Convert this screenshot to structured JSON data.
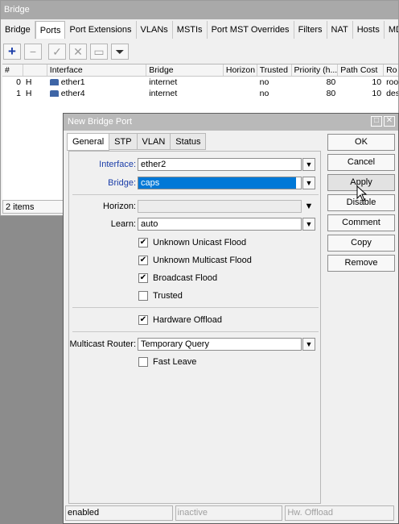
{
  "bridge_window": {
    "title": "Bridge",
    "tabs": [
      "Bridge",
      "Ports",
      "Port Extensions",
      "VLANs",
      "MSTIs",
      "Port MST Overrides",
      "Filters",
      "NAT",
      "Hosts",
      "MD"
    ],
    "active_tab": "Ports",
    "toolbar": [
      "add-icon",
      "remove-icon",
      "enable-icon",
      "disable-icon",
      "comment-icon",
      "filter-icon"
    ],
    "columns": [
      "#",
      "Interface",
      "Bridge",
      "Horizon",
      "Trusted",
      "Priority (h...",
      "Path Cost",
      "Ro"
    ],
    "rows": [
      {
        "num": "0",
        "flag": "H",
        "interface": "ether1",
        "bridge": "internet",
        "horizon": "",
        "trusted": "no",
        "priority": "80",
        "path_cost": "10",
        "role": "roo"
      },
      {
        "num": "1",
        "flag": "H",
        "interface": "ether4",
        "bridge": "internet",
        "horizon": "",
        "trusted": "no",
        "priority": "80",
        "path_cost": "10",
        "role": "des"
      }
    ],
    "status": "2 items"
  },
  "dialog": {
    "title": "New Bridge Port",
    "tabs": [
      "General",
      "STP",
      "VLAN",
      "Status"
    ],
    "active_tab": "General",
    "fields": {
      "interface": {
        "label": "Interface:",
        "value": "ether2"
      },
      "bridge": {
        "label": "Bridge:",
        "value": "caps"
      },
      "horizon": {
        "label": "Horizon:",
        "value": ""
      },
      "learn": {
        "label": "Learn:",
        "value": "auto"
      },
      "multicast_router": {
        "label": "Multicast Router:",
        "value": "Temporary Query"
      }
    },
    "checkboxes": {
      "unknown_unicast_flood": {
        "label": "Unknown Unicast Flood",
        "checked": true
      },
      "unknown_multicast_flood": {
        "label": "Unknown Multicast Flood",
        "checked": true
      },
      "broadcast_flood": {
        "label": "Broadcast Flood",
        "checked": true
      },
      "trusted": {
        "label": "Trusted",
        "checked": false
      },
      "hardware_offload": {
        "label": "Hardware Offload",
        "checked": true
      },
      "fast_leave": {
        "label": "Fast Leave",
        "checked": false
      }
    },
    "buttons": [
      "OK",
      "Cancel",
      "Apply",
      "Disable",
      "Comment",
      "Copy",
      "Remove"
    ],
    "status": [
      "enabled",
      "inactive",
      "Hw. Offload"
    ]
  }
}
